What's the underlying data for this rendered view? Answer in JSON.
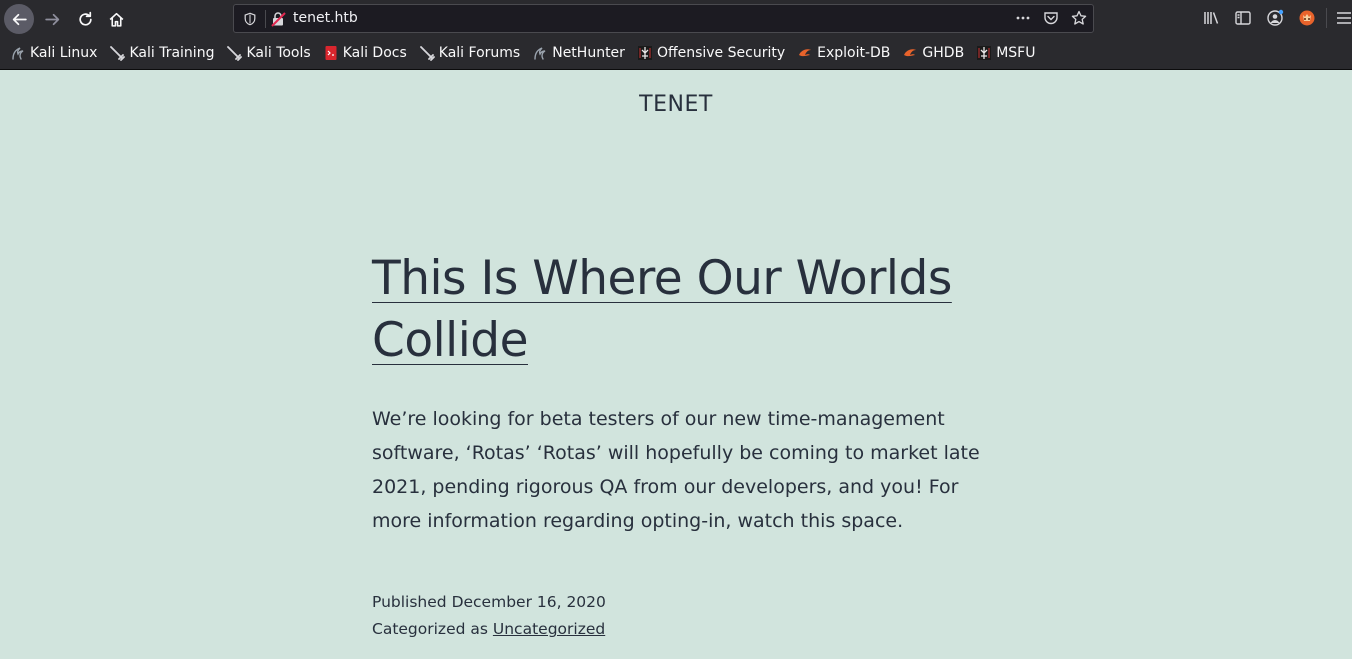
{
  "browser": {
    "url": "tenet.htb",
    "bookmarks": [
      {
        "label": "Kali Linux",
        "icon": "kali-dragon-icon"
      },
      {
        "label": "Kali Training",
        "icon": "kali-sword-icon"
      },
      {
        "label": "Kali Tools",
        "icon": "kali-sword-icon"
      },
      {
        "label": "Kali Docs",
        "icon": "kali-docs-icon"
      },
      {
        "label": "Kali Forums",
        "icon": "kali-sword-icon"
      },
      {
        "label": "NetHunter",
        "icon": "kali-dragon-icon"
      },
      {
        "label": "Offensive Security",
        "icon": "offsec-icon"
      },
      {
        "label": "Exploit-DB",
        "icon": "exploitdb-icon"
      },
      {
        "label": "GHDB",
        "icon": "exploitdb-icon"
      },
      {
        "label": "MSFU",
        "icon": "offsec-icon"
      }
    ]
  },
  "site": {
    "title": "TENET"
  },
  "post": {
    "title": "This Is Where Our Worlds Collide",
    "body": "We’re looking for beta testers of our new time-management software, ‘Rotas’ ‘Rotas’ will hopefully be coming to market late 2021, pending rigorous QA from our developers, and you! For more information regarding opting-in, watch this space.",
    "published_label": "Published",
    "published_date": "December 16, 2020",
    "category_label": "Categorized as",
    "category": "Uncategorized"
  },
  "colors": {
    "page_bg": "#d1e4dd",
    "text": "#28303d",
    "chrome_bg": "#2a2a2e"
  }
}
